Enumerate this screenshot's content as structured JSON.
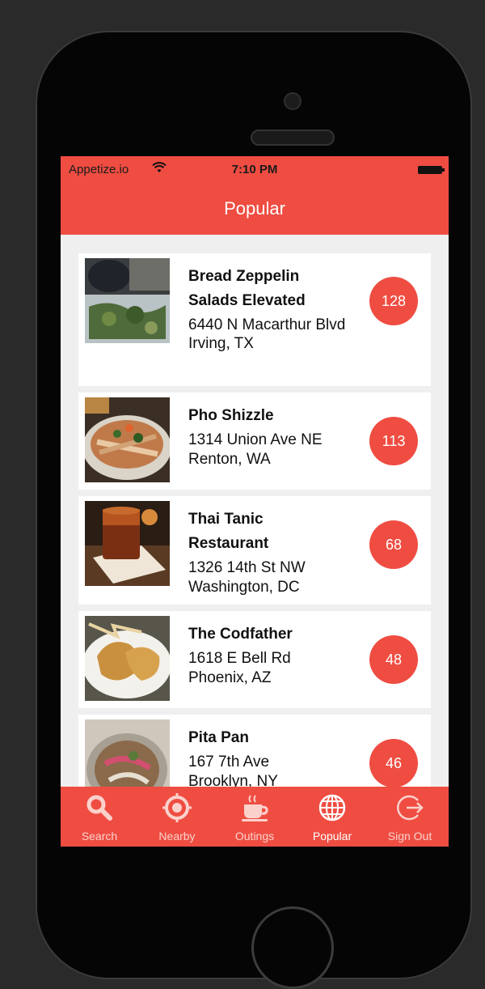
{
  "status": {
    "carrier": "Appetize.io",
    "time": "7:10 PM"
  },
  "header": {
    "title": "Popular"
  },
  "restaurants": [
    {
      "name": "Bread Zeppelin Salads Elevated",
      "address": "6440 N Macarthur Blvd",
      "city": "Irving, TX",
      "count": "128"
    },
    {
      "name": "Pho Shizzle",
      "address": "1314 Union Ave NE",
      "city": "Renton, WA",
      "count": "113"
    },
    {
      "name": "Thai Tanic Restaurant",
      "address": "1326 14th St NW",
      "city": "Washington, DC",
      "count": "68"
    },
    {
      "name": "The Codfather",
      "address": "1618 E Bell Rd",
      "city": "Phoenix, AZ",
      "count": "48"
    },
    {
      "name": "Pita Pan",
      "address": "167 7th Ave",
      "city": "Brooklyn, NY",
      "count": "46"
    }
  ],
  "tabs": [
    {
      "label": "Search",
      "icon": "search-icon"
    },
    {
      "label": "Nearby",
      "icon": "target-icon"
    },
    {
      "label": "Outings",
      "icon": "coffee-cup-icon"
    },
    {
      "label": "Popular",
      "icon": "globe-icon",
      "active": true
    },
    {
      "label": "Sign Out",
      "icon": "sign-out-icon"
    }
  ],
  "colors": {
    "accent": "#ef4d42",
    "background": "#efefef"
  }
}
